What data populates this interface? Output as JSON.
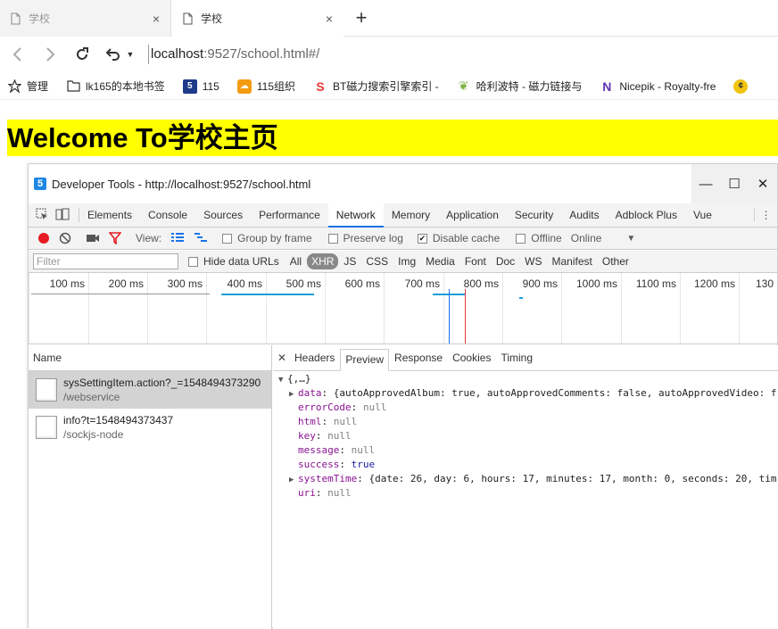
{
  "tabs": [
    {
      "label": "学校",
      "close": "×"
    },
    {
      "label": "学校",
      "close": "×"
    }
  ],
  "new_tab": "+",
  "address": {
    "host": "localhost",
    "rest": ":9527/school.html#/"
  },
  "bookmarks": [
    {
      "label": "管理",
      "icon": "star-icon"
    },
    {
      "label": "lk165的本地书签",
      "icon": "folder-icon"
    },
    {
      "label": "115",
      "icon": "115-icon"
    },
    {
      "label": "115组织",
      "icon": "cloud-icon"
    },
    {
      "label": "BT磁力搜索引擎索引 -",
      "icon": "s-icon"
    },
    {
      "label": "哈利波特 - 磁力链接与",
      "icon": "leaf-icon"
    },
    {
      "label": "Nicepik - Royalty-fre",
      "icon": "n-icon"
    }
  ],
  "page": {
    "heading": "Welcome To学校主页"
  },
  "devtools": {
    "title": "Developer Tools - http://localhost:9527/school.html",
    "tabs": [
      "Elements",
      "Console",
      "Sources",
      "Performance",
      "Network",
      "Memory",
      "Application",
      "Security",
      "Audits",
      "Adblock Plus",
      "Vue"
    ],
    "active_tab": "Network",
    "toolbar": {
      "view_label": "View:",
      "group_by_frame": "Group by frame",
      "preserve_log": "Preserve log",
      "disable_cache": "Disable cache",
      "offline": "Offline",
      "online": "Online"
    },
    "filter": {
      "placeholder": "Filter",
      "hide_data_urls": "Hide data URLs",
      "types": [
        "All",
        "XHR",
        "JS",
        "CSS",
        "Img",
        "Media",
        "Font",
        "Doc",
        "WS",
        "Manifest",
        "Other"
      ],
      "active_type": "XHR"
    },
    "timeline_ticks": [
      "100 ms",
      "200 ms",
      "300 ms",
      "400 ms",
      "500 ms",
      "600 ms",
      "700 ms",
      "800 ms",
      "900 ms",
      "1000 ms",
      "1100 ms",
      "1200 ms",
      "130"
    ],
    "name_header": "Name",
    "requests": [
      {
        "name": "sysSettingItem.action?_=1548494373290",
        "path": "/webservice"
      },
      {
        "name": "info?t=1548494373437",
        "path": "/sockjs-node"
      }
    ],
    "detail_tabs": [
      "Headers",
      "Preview",
      "Response",
      "Cookies",
      "Timing"
    ],
    "active_detail_tab": "Preview",
    "preview": {
      "root": "{,…}",
      "data_line": "{autoApprovedAlbum: true, autoApprovedComments: false, autoApprovedVideo: f",
      "errorCode": "null",
      "html": "null",
      "key": "null",
      "message": "null",
      "success": "true",
      "systemTime_line": "{date: 26, day: 6, hours: 17, minutes: 17, month: 0, seconds: 20, tim",
      "uri": "null"
    }
  }
}
